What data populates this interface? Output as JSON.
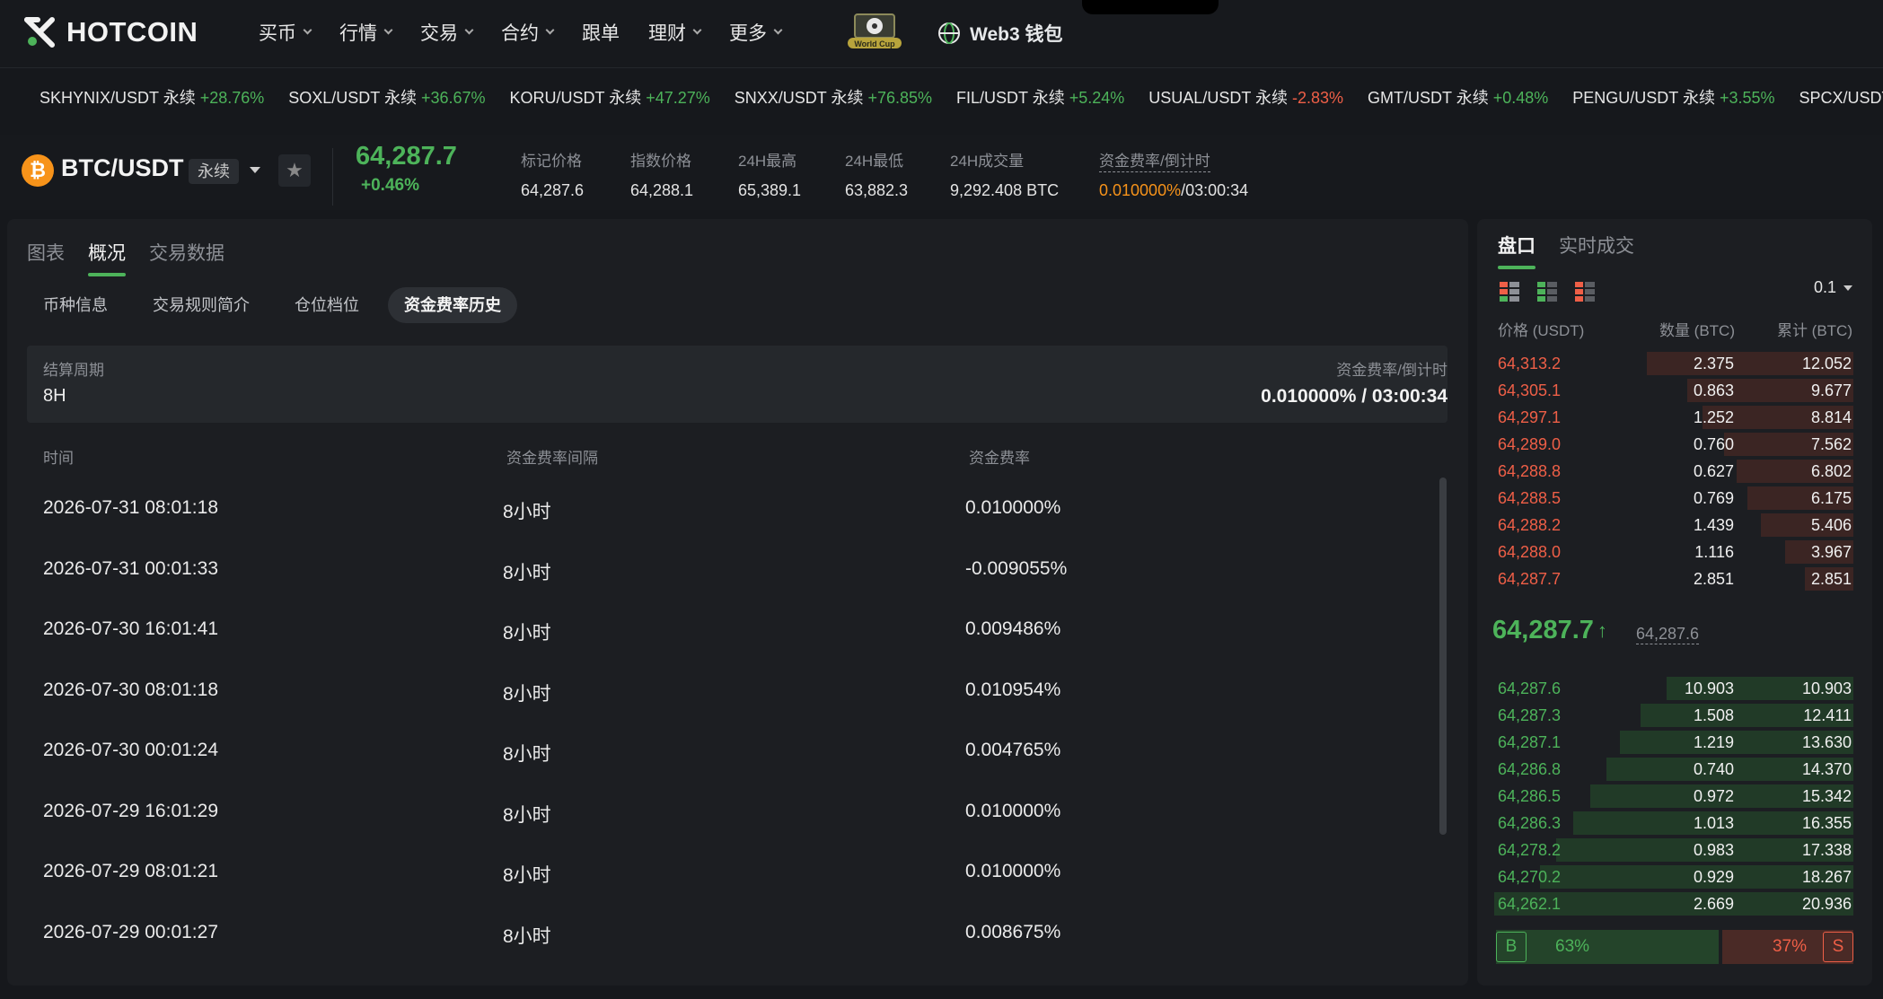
{
  "nav": {
    "logo": "HOTCOIN",
    "menu": [
      {
        "label": "买币",
        "dropdown": true
      },
      {
        "label": "行情",
        "dropdown": true
      },
      {
        "label": "交易",
        "dropdown": true
      },
      {
        "label": "合约",
        "dropdown": true
      },
      {
        "label": "跟单",
        "dropdown": false
      },
      {
        "label": "理财",
        "dropdown": true
      },
      {
        "label": "更多",
        "dropdown": true
      }
    ],
    "worldcup_badge": "World Cup",
    "web3_label": "Web3 钱包"
  },
  "ticker": [
    {
      "pair": "SKHYNIX/USDT 永续",
      "change": "+28.76%",
      "dir": "up"
    },
    {
      "pair": "SOXL/USDT 永续",
      "change": "+36.67%",
      "dir": "up"
    },
    {
      "pair": "KORU/USDT 永续",
      "change": "+47.27%",
      "dir": "up"
    },
    {
      "pair": "SNXX/USDT 永续",
      "change": "+76.85%",
      "dir": "up"
    },
    {
      "pair": "FIL/USDT 永续",
      "change": "+5.24%",
      "dir": "up"
    },
    {
      "pair": "USUAL/USDT 永续",
      "change": "-2.83%",
      "dir": "down"
    },
    {
      "pair": "GMT/USDT 永续",
      "change": "+0.48%",
      "dir": "up"
    },
    {
      "pair": "PENGU/USDT 永续",
      "change": "+3.55%",
      "dir": "up"
    },
    {
      "pair": "SPCX/USDT 永续",
      "change": "",
      "dir": "up"
    }
  ],
  "pair": {
    "icon": "₿",
    "name": "BTC/USDT",
    "type": "永续",
    "last_price": "64,287.7",
    "change": "+0.46%",
    "stats": {
      "mark_label": "标记价格",
      "mark_value": "64,287.6",
      "index_label": "指数价格",
      "index_value": "64,288.1",
      "high_label": "24H最高",
      "high_value": "65,389.1",
      "low_label": "24H最低",
      "low_value": "63,882.3",
      "vol_label": "24H成交量",
      "vol_value": "9,292.408 BTC",
      "funding_label": "资金费率/倒计时",
      "funding_rate": "0.010000%",
      "funding_countdown": "/03:00:34"
    }
  },
  "left": {
    "tabs": [
      "图表",
      "概况",
      "交易数据"
    ],
    "active_tab": 1,
    "sub_tabs": [
      "币种信息",
      "交易规则简介",
      "仓位档位",
      "资金费率历史"
    ],
    "active_sub_tab": 3,
    "settle_label": "结算周期",
    "settle_value": "8H",
    "rate_label": "资金费率/倒计时",
    "rate_value": "0.010000% / 03:00:34",
    "columns": [
      "时间",
      "资金费率间隔",
      "资金费率"
    ],
    "rows": [
      [
        "2026-07-31 08:01:18",
        "8小时",
        "0.010000%"
      ],
      [
        "2026-07-31 00:01:33",
        "8小时",
        "-0.009055%"
      ],
      [
        "2026-07-30 16:01:41",
        "8小时",
        "0.009486%"
      ],
      [
        "2026-07-30 08:01:18",
        "8小时",
        "0.010954%"
      ],
      [
        "2026-07-30 00:01:24",
        "8小时",
        "0.004765%"
      ],
      [
        "2026-07-29 16:01:29",
        "8小时",
        "0.010000%"
      ],
      [
        "2026-07-29 08:01:21",
        "8小时",
        "0.010000%"
      ],
      [
        "2026-07-29 00:01:27",
        "8小时",
        "0.008675%"
      ]
    ]
  },
  "orderbook": {
    "tabs": [
      "盘口",
      "实时成交"
    ],
    "active_tab": 0,
    "precision": "0.1",
    "columns": [
      "价格 (USDT)",
      "数量 (BTC)",
      "累计 (BTC)"
    ],
    "asks": [
      [
        "64,313.2",
        "2.375",
        "12.052"
      ],
      [
        "64,305.1",
        "0.863",
        "9.677"
      ],
      [
        "64,297.1",
        "1.252",
        "8.814"
      ],
      [
        "64,289.0",
        "0.760",
        "7.562"
      ],
      [
        "64,288.8",
        "0.627",
        "6.802"
      ],
      [
        "64,288.5",
        "0.769",
        "6.175"
      ],
      [
        "64,288.2",
        "1.439",
        "5.406"
      ],
      [
        "64,288.0",
        "1.116",
        "3.967"
      ],
      [
        "64,287.7",
        "2.851",
        "2.851"
      ]
    ],
    "mid_price": "64,287.7",
    "mid_arrow": "↑",
    "mark_price": "64,287.6",
    "bids": [
      [
        "64,287.6",
        "10.903",
        "10.903"
      ],
      [
        "64,287.3",
        "1.508",
        "12.411"
      ],
      [
        "64,287.1",
        "1.219",
        "13.630"
      ],
      [
        "64,286.8",
        "0.740",
        "14.370"
      ],
      [
        "64,286.5",
        "0.972",
        "15.342"
      ],
      [
        "64,286.3",
        "1.013",
        "16.355"
      ],
      [
        "64,278.2",
        "0.983",
        "17.338"
      ],
      [
        "64,270.2",
        "0.929",
        "18.267"
      ],
      [
        "64,262.1",
        "2.669",
        "20.936"
      ]
    ],
    "buy_tag": "B",
    "buy_pct": "63%",
    "sell_pct": "37%",
    "sell_tag": "S",
    "buy_ratio": 0.63
  },
  "colors": {
    "up": "#4db35a",
    "down": "#ef5f47",
    "accent": "#4db35a",
    "btc": "#f7931a"
  }
}
